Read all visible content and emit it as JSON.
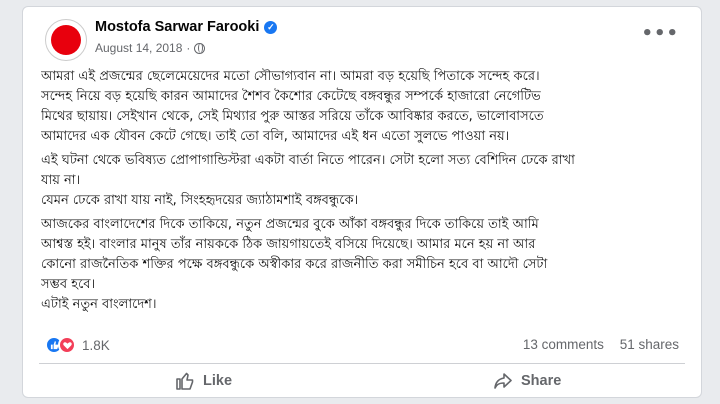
{
  "post": {
    "author": "Mostofa Sarwar Farooki",
    "date": "August 14, 2018",
    "separator": "·",
    "more_label": "•••",
    "paragraphs": [
      [
        "আমরা এই প্রজন্মের ছেলেমেয়েদের মতো সৌভাগ্যবান না। আমরা বড় হয়েছি পিতাকে সন্দেহ করে।",
        "সন্দেহ নিয়ে বড় হয়েছি কারন আমাদের শৈশব কৈশোর কেটেছে বঙ্গবন্ধুর সম্পর্কে হাজারো নেগেটিভ",
        "মিথের ছায়ায়। সেইখান থেকে, সেই মিথ্যার পুরু আস্তর সরিয়ে তাঁকে আবিষ্কার করতে, ভালোবাসতে",
        "আমাদের এক যৌবন কেটে গেছে। তাই তো বলি, আমাদের এই ধন এতো সুলভে পাওয়া নয়।"
      ],
      [
        "এই ঘটনা থেকে ভবিষ্যত প্রোপাগান্ডিস্টরা একটা বার্তা নিতে পারেন। সেটা হলো সত্য বেশিদিন ঢেকে রাখা",
        "যায় না।",
        "যেমন ঢেকে রাখা যায় নাই, সিংহহৃদয়ের জ্যাঠামশাই বঙ্গবন্ধুকে।"
      ],
      [
        "আজকের বাংলাদেশের দিকে তাকিয়ে, নতুন প্রজন্মের বুকে আঁকা বঙ্গবন্ধুর দিকে তাকিয়ে তাই আমি",
        "আশ্বস্ত হই। বাংলার মানুষ তাঁর নায়ককে ঠিক জায়গায়তেই বসিয়ে দিয়েছে। আমার মনে হয় না আর",
        "কোনো রাজনৈতিক শক্তির পক্ষে বঙ্গবন্ধুকে অস্বীকার করে রাজনীতি করা সমীচিন হবে বা আদৌ সেটা",
        "সম্ভব হবে।",
        "এটাই নতুন বাংলাদেশ।"
      ]
    ]
  },
  "stats": {
    "reaction_count": "1.8K",
    "comments": "13 comments",
    "shares": "51 shares"
  },
  "actions": {
    "like": "Like",
    "share": "Share"
  },
  "colors": {
    "accent": "#1877f2",
    "love": "#f33e58",
    "avatar_dot": "#e8000d",
    "secondary_text": "#65676b"
  }
}
